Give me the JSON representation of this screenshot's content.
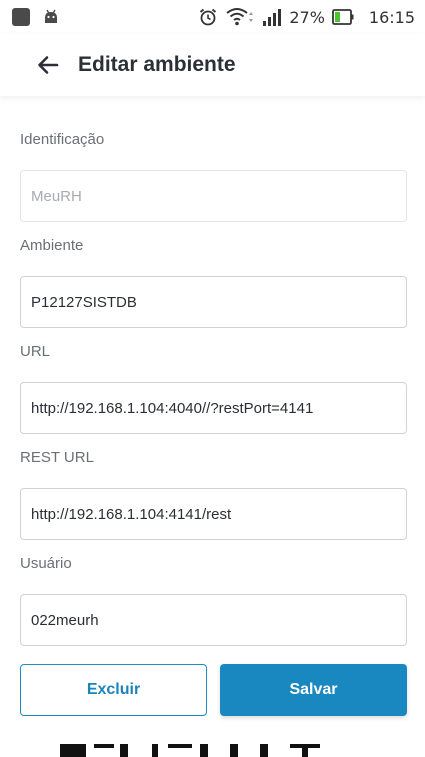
{
  "status_bar": {
    "battery_pct": "27%",
    "time": "16:15",
    "icons": [
      "square-notification-icon",
      "android-icon",
      "alarm-icon",
      "wifi-icon",
      "signal-icon",
      "battery-icon"
    ]
  },
  "app_bar": {
    "back_icon": "arrow-left-icon",
    "title": "Editar ambiente"
  },
  "form": {
    "fields": [
      {
        "label": "Identificação",
        "value": "MeuRH",
        "readonly": true
      },
      {
        "label": "Ambiente",
        "value": "P12127SISTDB"
      },
      {
        "label": "URL",
        "value": "http://192.168.1.104:4040//?restPort=4141"
      },
      {
        "label": "REST URL",
        "value": "http://192.168.1.104:4141/rest"
      },
      {
        "label": "Usuário",
        "value": "022meurh"
      }
    ]
  },
  "actions": {
    "delete_label": "Excluir",
    "save_label": "Salvar"
  },
  "colors": {
    "primary": "#1a88c0",
    "title_text": "#2b3038",
    "label_text": "#6b7075"
  }
}
